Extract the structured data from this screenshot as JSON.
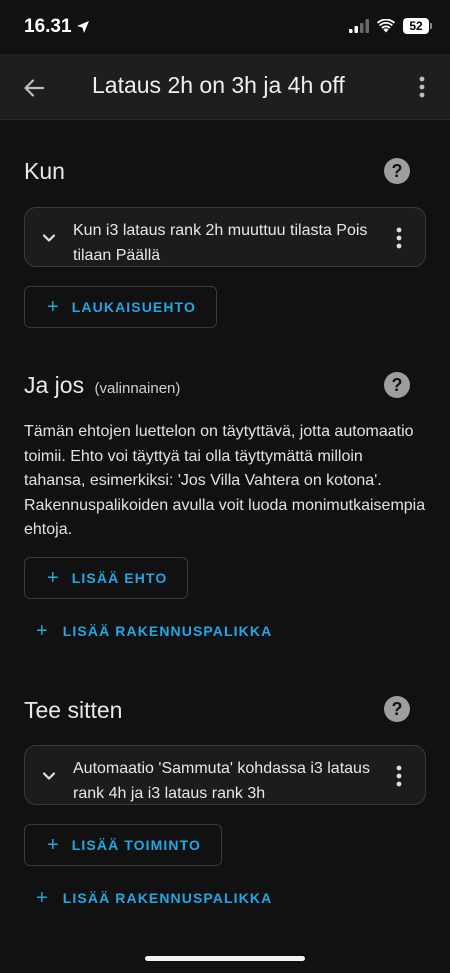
{
  "status_bar": {
    "time": "16.31",
    "battery": "52"
  },
  "app_bar": {
    "title": "Lataus 2h on 3h ja 4h off"
  },
  "trigger_section": {
    "title": "Kun",
    "card_text": "Kun i3 lataus rank 2h muuttuu tilasta Pois tilaan Päällä",
    "add_button": "LAUKAISUEHTO"
  },
  "condition_section": {
    "title": "Ja jos",
    "optional_label": "(valinnainen)",
    "description": "Tämän ehtojen luettelon on täytyttävä, jotta automaatio toimii. Ehto voi täyttyä tai olla täyttymättä milloin tahansa, esimerkiksi: 'Jos Villa Vahtera on kotona'. Rakennuspalikoiden avulla voit luoda monimutkaisempia ehtoja.",
    "add_condition_button": "LISÄÄ EHTO",
    "add_building_block_button": "LISÄÄ RAKENNUSPALIKKA"
  },
  "action_section": {
    "title": "Tee sitten",
    "card_text": "Automaatio 'Sammuta' kohdassa i3 lataus rank 4h ja i3 lataus rank 3h",
    "add_action_button": "LISÄÄ TOIMINTO",
    "add_building_block_button": "LISÄÄ RAKENNUSPALIKKA"
  },
  "icons": {
    "help": "?",
    "plus": "+"
  },
  "colors": {
    "accent": "#22a7e6",
    "background": "#111111",
    "card": "#1c1c1c"
  }
}
